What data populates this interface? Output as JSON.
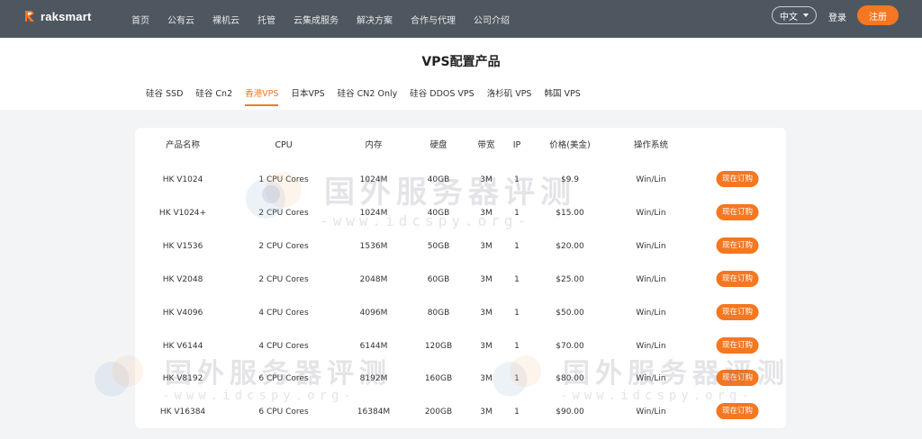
{
  "header": {
    "brand": "raksmart",
    "nav": [
      "首页",
      "公有云",
      "裸机云",
      "托管",
      "云集成服务",
      "解决方案",
      "合作与代理",
      "公司介绍"
    ],
    "language": "中文",
    "login": "登录",
    "signup": "注册"
  },
  "page": {
    "title": "VPS配置产品",
    "tabs": [
      "硅谷 SSD",
      "硅谷 Cn2",
      "香港VPS",
      "日本VPS",
      "硅谷 CN2 Only",
      "硅谷 DDOS VPS",
      "洛杉矶 VPS",
      "韩国 VPS"
    ],
    "active_tab": "香港VPS"
  },
  "table": {
    "headers": [
      "产品名称",
      "CPU",
      "内存",
      "硬盘",
      "带宽",
      "IP",
      "价格(美金)",
      "操作系统"
    ],
    "order_label": "现在订购",
    "rows": [
      [
        "HK V1024",
        "1 CPU Cores",
        "1024M",
        "40GB",
        "3M",
        "1",
        "$9.9",
        "Win/Lin"
      ],
      [
        "HK V1024+",
        "2 CPU Cores",
        "1024M",
        "40GB",
        "3M",
        "1",
        "$15.00",
        "Win/Lin"
      ],
      [
        "HK V1536",
        "2 CPU Cores",
        "1536M",
        "50GB",
        "3M",
        "1",
        "$20.00",
        "Win/Lin"
      ],
      [
        "HK V2048",
        "2 CPU Cores",
        "2048M",
        "60GB",
        "3M",
        "1",
        "$25.00",
        "Win/Lin"
      ],
      [
        "HK V4096",
        "4 CPU Cores",
        "4096M",
        "80GB",
        "3M",
        "1",
        "$50.00",
        "Win/Lin"
      ],
      [
        "HK V6144",
        "4 CPU Cores",
        "6144M",
        "120GB",
        "3M",
        "1",
        "$70.00",
        "Win/Lin"
      ],
      [
        "HK V8192",
        "6 CPU Cores",
        "8192M",
        "160GB",
        "3M",
        "1",
        "$80.00",
        "Win/Lin"
      ],
      [
        "HK V16384",
        "6 CPU Cores",
        "16384M",
        "200GB",
        "3M",
        "1",
        "$90.00",
        "Win/Lin"
      ]
    ]
  },
  "watermark": {
    "text": "国外服务器评测",
    "url": "-www.idcspy.org-"
  },
  "colors": {
    "accent": "#f47721",
    "header_bg": "#4e565f",
    "page_bg": "#f3f4f6"
  }
}
